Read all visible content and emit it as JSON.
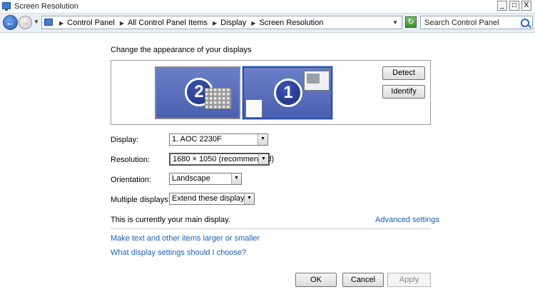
{
  "window": {
    "title": "Screen Resolution",
    "controls": {
      "minimize": "_",
      "maximize": "□",
      "close": "X"
    }
  },
  "address_bar": {
    "back_icon": "back-arrow-icon",
    "forward_icon": "forward-arrow-icon",
    "breadcrumbs": [
      "Control Panel",
      "All Control Panel Items",
      "Display",
      "Screen Resolution"
    ],
    "search_placeholder": "Search Control Panel"
  },
  "main": {
    "heading": "Change the appearance of your displays",
    "monitors": [
      {
        "number": "2",
        "selected": false
      },
      {
        "number": "1",
        "selected": true
      }
    ],
    "detect_label": "Detect",
    "identify_label": "Identify",
    "fields": {
      "display": {
        "label": "Display:",
        "value": "1. AOC 2230F"
      },
      "resolution": {
        "label": "Resolution:",
        "value": "1680 × 1050 (recommended)"
      },
      "orientation": {
        "label": "Orientation:",
        "value": "Landscape"
      },
      "multiple_displays": {
        "label": "Multiple displays:",
        "value": "Extend these displays"
      }
    },
    "main_display_text": "This is currently your main display.",
    "advanced_settings": "Advanced settings",
    "link_text_size": "Make text and other items larger or smaller",
    "link_help": "What display settings should I choose?"
  },
  "buttons": {
    "ok": "OK",
    "cancel": "Cancel",
    "apply": "Apply"
  },
  "colors": {
    "link": "#1a5fb4",
    "monitor_fill": "#4a5fb0"
  }
}
